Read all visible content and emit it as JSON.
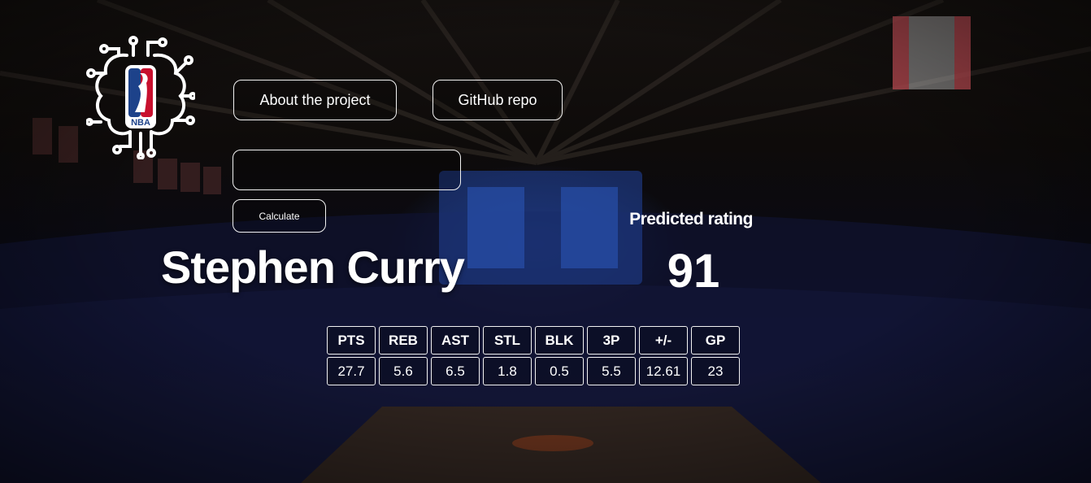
{
  "nav": {
    "about_label": "About the project",
    "github_label": "GitHub repo"
  },
  "logo": {
    "text": "NBA",
    "icon": "nba-brain-circuit-icon"
  },
  "search": {
    "value": "",
    "placeholder": ""
  },
  "calculate_label": "Calculate",
  "player": {
    "name": "Stephen Curry"
  },
  "prediction": {
    "label": "Predicted rating",
    "value": "91"
  },
  "stats": {
    "headers": [
      "PTS",
      "REB",
      "AST",
      "STL",
      "BLK",
      "3P",
      "+/-",
      "GP"
    ],
    "values": [
      "27.7",
      "5.6",
      "6.5",
      "1.8",
      "0.5",
      "5.5",
      "12.61",
      "23"
    ]
  },
  "colors": {
    "border": "#f2f2f2",
    "text": "#ffffff",
    "logo_blue": "#1d428a",
    "logo_red": "#c8102e"
  }
}
